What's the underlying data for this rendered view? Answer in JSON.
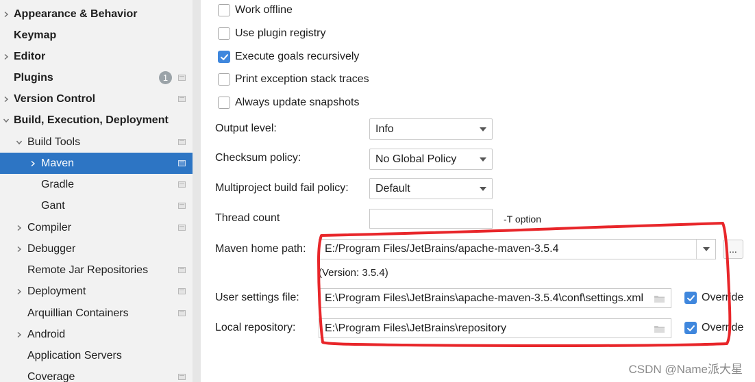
{
  "sidebar": {
    "items": [
      {
        "label": "Appearance & Behavior",
        "bold": true,
        "chevron": "right",
        "indent": 0
      },
      {
        "label": "Keymap",
        "bold": true,
        "chevron": "",
        "indent": 0
      },
      {
        "label": "Editor",
        "bold": true,
        "chevron": "right",
        "indent": 0
      },
      {
        "label": "Plugins",
        "bold": true,
        "chevron": "",
        "indent": 0,
        "badge": "1",
        "project_icon": true
      },
      {
        "label": "Version Control",
        "bold": true,
        "chevron": "right",
        "indent": 0,
        "project_icon": true
      },
      {
        "label": "Build, Execution, Deployment",
        "bold": true,
        "chevron": "down",
        "indent": 0
      },
      {
        "label": "Build Tools",
        "bold": false,
        "chevron": "down",
        "indent": 1,
        "project_icon": true
      },
      {
        "label": "Maven",
        "bold": false,
        "chevron": "right",
        "indent": 2,
        "project_icon": true,
        "selected": true
      },
      {
        "label": "Gradle",
        "bold": false,
        "chevron": "",
        "indent": 2,
        "project_icon": true
      },
      {
        "label": "Gant",
        "bold": false,
        "chevron": "",
        "indent": 2,
        "project_icon": true
      },
      {
        "label": "Compiler",
        "bold": false,
        "chevron": "right",
        "indent": 1,
        "project_icon": true
      },
      {
        "label": "Debugger",
        "bold": false,
        "chevron": "right",
        "indent": 1
      },
      {
        "label": "Remote Jar Repositories",
        "bold": false,
        "chevron": "",
        "indent": 1,
        "project_icon": true
      },
      {
        "label": "Deployment",
        "bold": false,
        "chevron": "right",
        "indent": 1,
        "project_icon": true
      },
      {
        "label": "Arquillian Containers",
        "bold": false,
        "chevron": "",
        "indent": 1,
        "project_icon": true
      },
      {
        "label": "Android",
        "bold": false,
        "chevron": "right",
        "indent": 1
      },
      {
        "label": "Application Servers",
        "bold": false,
        "chevron": "",
        "indent": 1
      },
      {
        "label": "Coverage",
        "bold": false,
        "chevron": "",
        "indent": 1,
        "project_icon": true
      }
    ]
  },
  "options": {
    "work_offline": {
      "label": "Work offline",
      "checked": false
    },
    "use_plugin_registry": {
      "label": "Use plugin registry",
      "checked": false
    },
    "execute_goals_recursively": {
      "label": "Execute goals recursively",
      "checked": true
    },
    "print_exception_stack_traces": {
      "label": "Print exception stack traces",
      "checked": false
    },
    "always_update_snapshots": {
      "label": "Always update snapshots",
      "checked": false
    }
  },
  "form": {
    "output_level": {
      "label": "Output level:",
      "value": "Info"
    },
    "checksum_policy": {
      "label": "Checksum policy:",
      "value": "No Global Policy"
    },
    "multiproject_fail_policy": {
      "label": "Multiproject build fail policy:",
      "value": "Default"
    },
    "thread_count": {
      "label": "Thread count",
      "value": "",
      "hint": "-T option"
    },
    "maven_home": {
      "label": "Maven home path:",
      "value": "E:/Program Files/JetBrains/apache-maven-3.5.4",
      "version": "(Version: 3.5.4)",
      "browse_label": "..."
    },
    "user_settings": {
      "label": "User settings file:",
      "value": "E:\\Program Files\\JetBrains\\apache-maven-3.5.4\\conf\\settings.xml",
      "override_label": "Override",
      "override_checked": true
    },
    "local_repository": {
      "label": "Local repository:",
      "value": "E:\\Program Files\\JetBrains\\repository",
      "override_label": "Override",
      "override_checked": true
    }
  },
  "watermark": "CSDN @Name派大星",
  "colors": {
    "selection": "#2d75c4",
    "checkbox_checked": "#3f87dd",
    "annotation_red": "#e8262a"
  }
}
